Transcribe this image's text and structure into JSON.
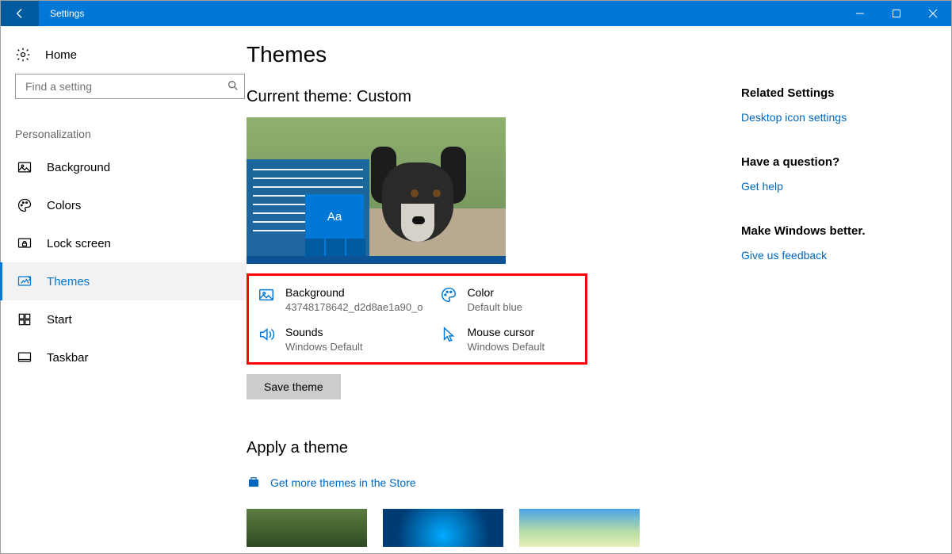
{
  "window": {
    "title": "Settings"
  },
  "sidebar": {
    "home": "Home",
    "search_placeholder": "Find a setting",
    "section": "Personalization",
    "items": [
      {
        "label": "Background"
      },
      {
        "label": "Colors"
      },
      {
        "label": "Lock screen"
      },
      {
        "label": "Themes"
      },
      {
        "label": "Start"
      },
      {
        "label": "Taskbar"
      }
    ]
  },
  "main": {
    "title": "Themes",
    "current_theme_label": "Current theme: Custom",
    "preview_tile_text": "Aa",
    "props": {
      "background": {
        "title": "Background",
        "sub": "43748178642_d2d8ae1a90_o"
      },
      "color": {
        "title": "Color",
        "sub": "Default blue"
      },
      "sounds": {
        "title": "Sounds",
        "sub": "Windows Default"
      },
      "cursor": {
        "title": "Mouse cursor",
        "sub": "Windows Default"
      }
    },
    "save_button": "Save theme",
    "apply_heading": "Apply a theme",
    "store_link": "Get more themes in the Store"
  },
  "aside": {
    "related_heading": "Related Settings",
    "related_link": "Desktop icon settings",
    "question_heading": "Have a question?",
    "question_link": "Get help",
    "feedback_heading": "Make Windows better.",
    "feedback_link": "Give us feedback"
  }
}
